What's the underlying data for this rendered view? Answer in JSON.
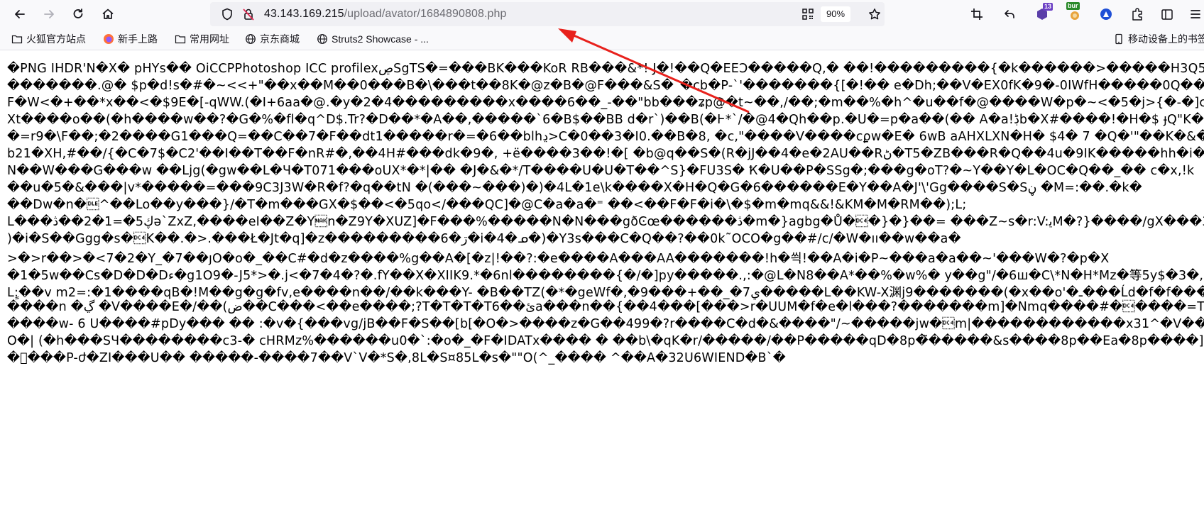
{
  "browser": {
    "url_host": "43.143.169.215",
    "url_path": "/upload/avator/1684890808.php",
    "zoom": "90%",
    "extension_badge_1": "13",
    "extension_badge_2": "bur",
    "annotation_color": "#e8211c"
  },
  "bookmarks": [
    {
      "label": "火狐官方站点",
      "icon": "folder-icon"
    },
    {
      "label": "新手上路",
      "icon": "firefox-icon"
    },
    {
      "label": "常用网址",
      "icon": "folder-icon"
    },
    {
      "label": "京东商城",
      "icon": "globe-icon"
    },
    {
      "label": "Struts2 Showcase - ...",
      "icon": "globe-icon"
    },
    {
      "label": "移动设备上的书签",
      "icon": "mobile-icon"
    }
  ],
  "content": {
    "lines": [
      "�PNG  IHDR'N�X� pHYs�� OiCCPPhotoshop ICC profilexڝSgTS�=���BK���KoR RB���&*! J�!��Q�EEƆ�����Q,� ��!���������{�k������>�����H3Q5��B",
      "�������.@� $p�d!s�#�~<<+\"��x��M��0���B�\\���t��8K�@z�B�@F���&S�`�cb�P-`'�������{[�!�� e�Dh;��V�EX0fK�9�-0IWfH�����0Q��)(`�##x��",
      "F�W<�+��*x��<�$9E�[-qWW.(�I+6aa�@.�y�2�4���������x����6��_-��\"bb���ʑp@�t~��,/��;�m��%�h^�u��f�@����W�p�~<�5�j>{�-�]c�K'",
      "Xt����o��(�h����w��?�G�%�fl�q^D$.Tr?�D��*�A��,�����`6�B$��BB d�r`)��B(�Ͱ*`/�@4�Qh��p.�U�=p�a��(�� A�a!ڋb�X#����!�H�$ ɟQ\"K�5H1R�T UH",
      "�=r9�\\F��;�2����G1���Q=��C��7�F��dt1�����r�=�6��blhڍ>C�0��3�I0.��B�8, �c,\"����V����cϼw�E� 6wB aAHXLXN�H� $4� 7 �Q�'\"��K�&���",
      "b21�XH,#��/{�C�7$�C2'��I��T��F�nR#�,��4H#���dk�9�, +ë����3��!�[ �b@q��S�(R�jJ��4�e�2AU��Rڻ�T5�ZB���R�Q��4u�9IK�����hh�i��t�ٻ",
      "N��W���G���w ��Ljg(�gw��L�Ч�T071���oUX*�*|�� �J�&�*/T����U�U�T��^S}�FU3S� Ҟ�U��P�SSg�;���g�oT?�~Y��Y�L�OC�Q��_�� c�x,!k",
      "��u�5�&���|v*�����=���9C3J3W�R�f?�q��tN �(���~���)�)�4L�1e\\k����X�H�Q�G�6������E�Y��A�J'\\'Gg����S�Sڼ �M=:��.�k�",
      "��Dw�n�\u0010^��Lo��y���}/�T�m���GX�$��<�5qo</���QC]�@C�a�a�⁼ ��<��F�F�i�\\�$�m�mq&&!&KM�M�RM��);L;",
      "L���ڮ5�=1�2��ڎǝ`ZxZ,����eI��Z�Y\u0015n�Z9Y�XUZ]�F���%�����N�N���gðϾœ������ڎ�m�}agbg�Ů�\u0014�}�}��= ���Z~s�r:V:ﻳM�?}����/gX���3�",
      ")�i�S��Ggg�s�\u0014K��.�>.���Ł�Jt�q]�z���������6�ڗ�i�4�ᓄ�)�Y3s���C�Q��?��0k˜OCO�g��#/c/�W�ıı��w��a�",
      ">�>r��>�<7�2�Y_�7��ȷO�o�_��C#�d�z����%g��A�[�z|!��?:�e����A���AA�������!h�씍!��A�i�P~���a�a��~'���W�?�p�X",
      "�1�5w��Cs�D�D�Dء�g1O9�-J5*>�.j<�7�4�?�.fY��X�XIIK9.*�6nl��������{�/�]py�����.,:�@L�N8��A*��%�w%� y��g\"/�6ш�C\\*N�H*Mz�等5y$�3�,帼'���L",
      "Lٍ:��v m2=:�1����qB�!M��g�g�fv,e����n��/��k���Y- �B��TZ(�*�geWf�,�9���+��_�7ي�����L��KW-X渊j9�������(�x��o'�ـ���Ĺd�f�f���-�[",
      "����n �ڲ �V����E�/��(ض��C���<��e����;?T�T�T�T6��ئa���n��{��4���[���>r�UUM�f�e�l���?�������m]�Nmq����#�\u0014����=TR��+G�",
      "����w- 6 U����#pDy��� �� :�v�{���vg/jB��F�S��[b[�O�>����z�G��499�?r����C�d�&����\"/~�����jw�\u0014m|������������x31^�V���w�w��",
      "O�| (�h���SЧ��������c3-� cHRMz%������u0�`:�o�_�F�IDATx���� � ��b\\�qK�r/�����/��P�����qD�8p�̃�����&s����8p��Ea�8p����]8��9ۂP��",
      "��ׄ��P-ժ�ZI���U�� �����-����7��V`V�*S�,8L�S¤85L�s�\"\"O(^_���� ^��A�32U6WIEND�B`�"
    ]
  }
}
